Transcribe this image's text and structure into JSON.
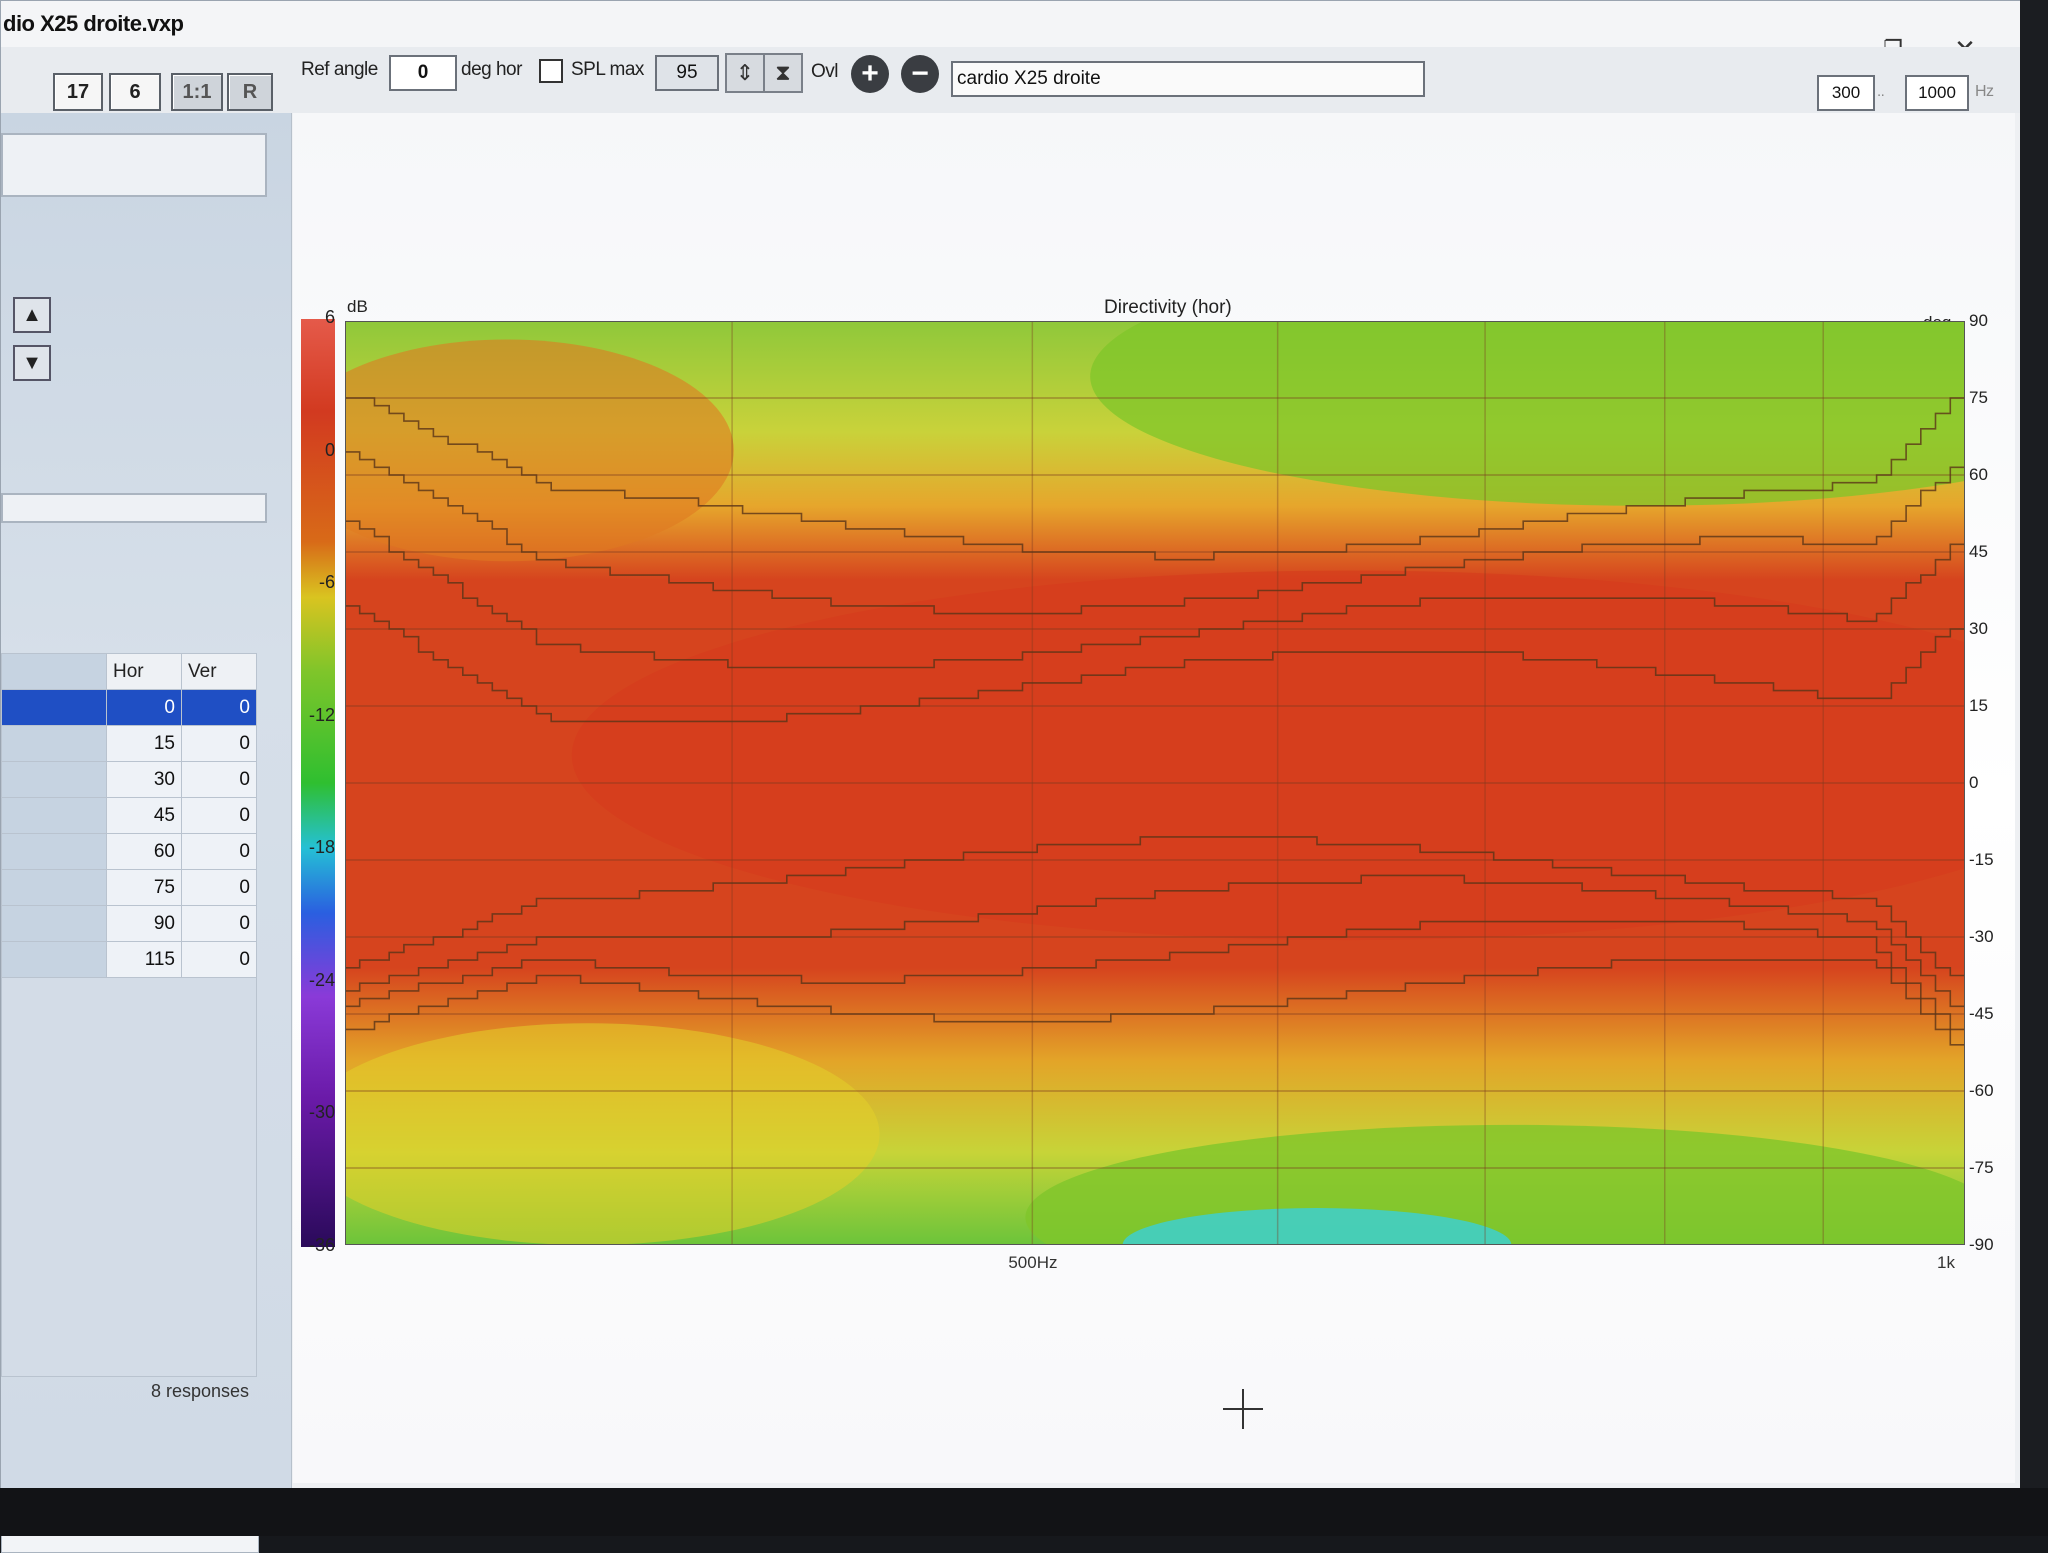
{
  "window": {
    "title": "dio X25 droite.vxp",
    "controls": {
      "minimize": "—",
      "maximize": "❐",
      "close": "✕"
    }
  },
  "toolbar": {
    "box1": "17",
    "box2": "6",
    "box3": "1:1",
    "box4": "R",
    "ref_angle_label": "Ref angle",
    "ref_angle_value": "0",
    "deg_hor_label": "deg hor",
    "spl_max_label": "SPL max",
    "spl_max_value": "95",
    "ovl_label": "Ovl",
    "name_value": "cardio X25 droite",
    "freq_min": "300",
    "freq_sep": "..",
    "freq_max": "1000",
    "freq_unit": "Hz"
  },
  "table": {
    "headers": [
      "",
      "Hor",
      "Ver"
    ],
    "rows": [
      {
        "hor": "0",
        "ver": "0",
        "selected": true
      },
      {
        "hor": "15",
        "ver": "0",
        "selected": false
      },
      {
        "hor": "30",
        "ver": "0",
        "selected": false
      },
      {
        "hor": "45",
        "ver": "0",
        "selected": false
      },
      {
        "hor": "60",
        "ver": "0",
        "selected": false
      },
      {
        "hor": "75",
        "ver": "0",
        "selected": false
      },
      {
        "hor": "90",
        "ver": "0",
        "selected": false
      },
      {
        "hor": "115",
        "ver": "0",
        "selected": false
      }
    ],
    "footer": "8 responses"
  },
  "chart_data": {
    "type": "heatmap",
    "title": "Directivity (hor)",
    "colorbar_unit": "dB",
    "colorbar_ticks": [
      "6",
      "0",
      "-6",
      "-12",
      "-18",
      "-24",
      "-30",
      "-36"
    ],
    "y_unit": "deg",
    "y_ticks": [
      "90",
      "75",
      "60",
      "45",
      "30",
      "15",
      "0",
      "-15",
      "-30",
      "-45",
      "-60",
      "-75",
      "-90"
    ],
    "x_ticks": [
      "500Hz",
      "1k"
    ],
    "xlim": [
      300,
      1000
    ],
    "ylim": [
      -90,
      90
    ],
    "zlim": [
      -36,
      6
    ],
    "contours_db": [
      -3,
      -6,
      -9,
      -12
    ],
    "colors": {
      "hot": "#d63a1c",
      "warm": "#e07a22",
      "yellow": "#e3cf2a",
      "green": "#7fc52a",
      "cyan": "#3ad0d8"
    }
  }
}
